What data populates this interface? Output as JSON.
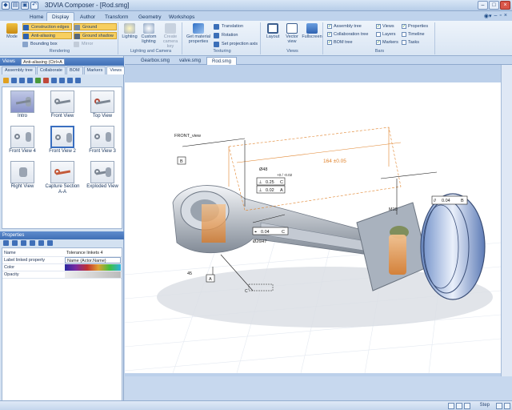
{
  "app": {
    "title": "3DVIA Composer - [Rod.smg]"
  },
  "tabs": [
    {
      "label": "Home"
    },
    {
      "label": "Display"
    },
    {
      "label": "Author"
    },
    {
      "label": "Transform"
    },
    {
      "label": "Geometry"
    },
    {
      "label": "Workshops"
    }
  ],
  "ribbon": {
    "rendering": {
      "label": "Rendering",
      "mode": "Mode",
      "construction_edges": "Construction edges",
      "anti_aliasing": "Anti-aliasing",
      "bounding_box": "Bounding box",
      "ground": "Ground",
      "ground_shadow": "Ground shadow",
      "mirror": "Mirror"
    },
    "lighting": {
      "label": "Lighting and Camera",
      "lighting": "Lighting",
      "custom_lighting": "Custom lighting",
      "create_camera_key": "Create camera key"
    },
    "texturing": {
      "label": "Texturing",
      "get_material": "Get material properties",
      "translation": "Translation",
      "rotation": "Rotation",
      "set_projection": "Set projection axis"
    },
    "views": {
      "label": "Views",
      "layout": "Layout",
      "vector_view": "Vector view",
      "fullscreen": "Fullscreen"
    },
    "bars": {
      "label": "Bars",
      "items": [
        {
          "label": "Assembly tree",
          "checked": true
        },
        {
          "label": "Collaboration tree",
          "checked": true
        },
        {
          "label": "BOM tree",
          "checked": true
        },
        {
          "label": "Views",
          "checked": true
        },
        {
          "label": "Layers",
          "checked": false
        },
        {
          "label": "Markers",
          "checked": true
        },
        {
          "label": "Properties",
          "checked": true
        },
        {
          "label": "Timeline",
          "checked": false
        },
        {
          "label": "Tasks",
          "checked": false
        }
      ]
    }
  },
  "left_panel": {
    "views_header": "Views",
    "views_mode": "Anti-aliasing (Ctrl+A",
    "subtabs": [
      {
        "label": "Assembly tree"
      },
      {
        "label": "Collaborate"
      },
      {
        "label": "BOM"
      },
      {
        "label": "Markers"
      },
      {
        "label": "Views"
      }
    ],
    "thumbnails": [
      {
        "label": "Intro"
      },
      {
        "label": "Front View"
      },
      {
        "label": "Top View"
      },
      {
        "label": "Front View 4"
      },
      {
        "label": "Front View 2"
      },
      {
        "label": "Front View 3"
      },
      {
        "label": "Right View"
      },
      {
        "label": "Capture Section A-A"
      },
      {
        "label": "Exploded View"
      }
    ],
    "properties_header": "Properties",
    "properties": [
      {
        "key": "Name",
        "value": "Tolerance linkets 4"
      },
      {
        "key": "Label linked property",
        "value": "Name (Actor.Name)"
      },
      {
        "key": "Color",
        "value": ""
      },
      {
        "key": "Opacity",
        "value": ""
      }
    ]
  },
  "document_tabs": [
    {
      "label": "Gearbox.smg"
    },
    {
      "label": "valve.smg"
    },
    {
      "label": "Rod.smg"
    }
  ],
  "canvas": {
    "view_label": "FRONT_view",
    "dim_main": "164 ±0.05",
    "diameter": "Ø48",
    "diameter_tol": "+0 / -0.02",
    "tol_flatness": "0.25",
    "tol_flat_ref": "C",
    "tol_perp": "0.02",
    "tol_perp_ref": "A",
    "tol_parallel": "0.04",
    "tol_parallel_ref": "B",
    "tol_pos": "0.04",
    "tol_pos_ref": "C",
    "hole": "Ø26H7",
    "datum_b": "B",
    "datum_a": "A",
    "datum_c": "C",
    "angle": "45",
    "thread": "M10"
  },
  "status": {
    "step": "Step"
  }
}
